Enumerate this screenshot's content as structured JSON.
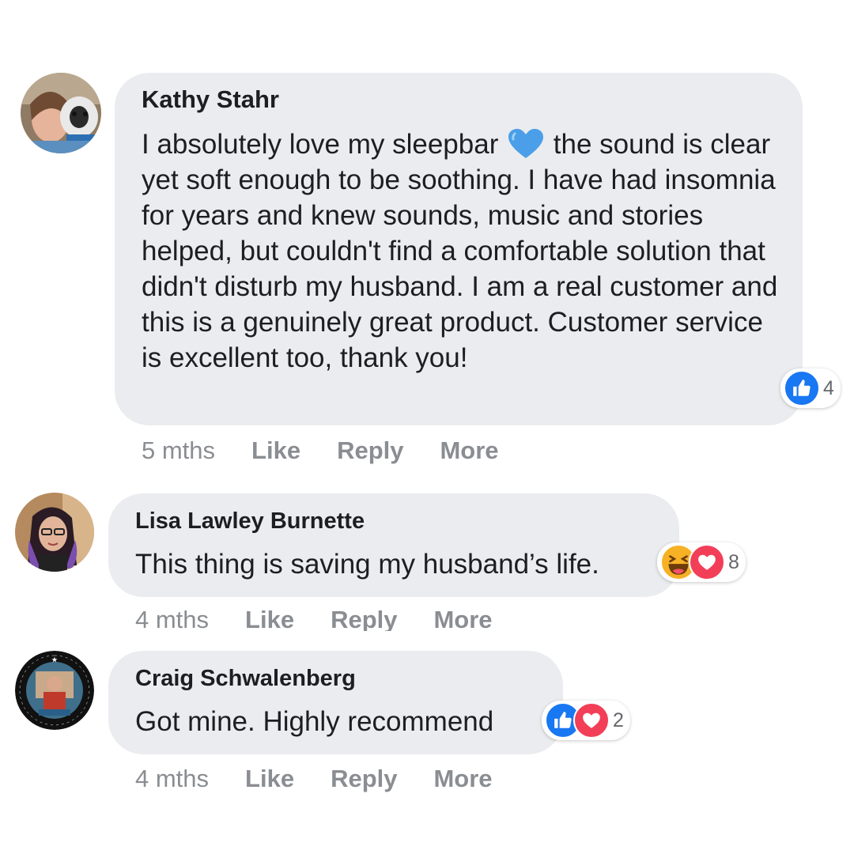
{
  "comments": [
    {
      "author": "Kathy Stahr",
      "text_before_emoji": "I absolutely love my sleepbar ",
      "emoji": "blue-heart",
      "text_after_emoji": " the sound is clear yet soft enough to be soothing. I have had insomnia for years and knew sounds, music and stories helped, but couldn't find a comfortable solution that didn't disturb my husband. I am a real customer and this is a genuinely great product. Customer service is excellent too, thank you!",
      "reactions": {
        "icons": [
          "like-icon"
        ],
        "count": "4"
      },
      "time": "5 mths",
      "like_label": "Like",
      "reply_label": "Reply",
      "more_label": "More"
    },
    {
      "author": "Lisa Lawley Burnette",
      "text": "This thing is saving my husband’s life.",
      "reactions": {
        "icons": [
          "haha-icon",
          "love-icon"
        ],
        "count": "8"
      },
      "time": "4 mths",
      "like_label": "Like",
      "reply_label": "Reply",
      "more_label": "More"
    },
    {
      "author": "Craig Schwalenberg",
      "text": "Got mine. Highly recommend",
      "reactions": {
        "icons": [
          "like-icon",
          "love-icon"
        ],
        "count": "2"
      },
      "time": "4 mths",
      "like_label": "Like",
      "reply_label": "Reply",
      "more_label": "More"
    }
  ],
  "colors": {
    "bubble": "#ebecef",
    "action_gray": "#8a8d91",
    "like_blue": "#1877f2",
    "love_red": "#f33e58",
    "haha_yellow": "#f7b125"
  }
}
